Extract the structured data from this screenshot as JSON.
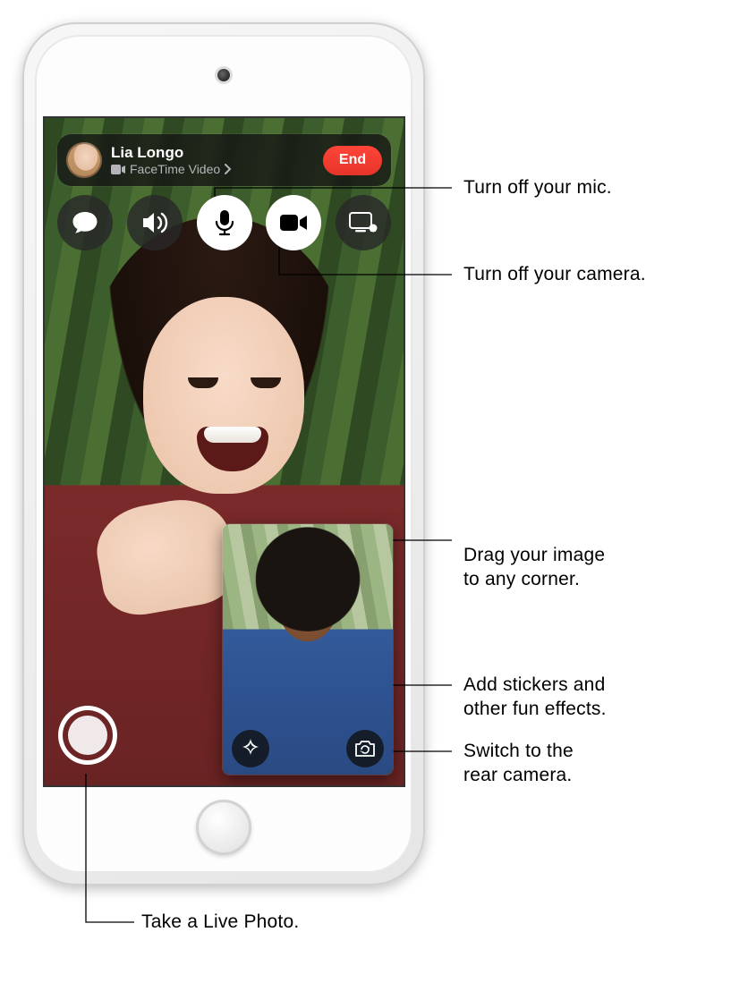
{
  "caller": {
    "name": "Lia Longo",
    "subtitle": "FaceTime Video"
  },
  "buttons": {
    "end": "End"
  },
  "icons": {
    "messages": "messages-icon",
    "speaker": "speaker-icon",
    "mic": "microphone-icon",
    "camera": "video-camera-icon",
    "share": "share-screen-icon",
    "effects": "effects-star-icon",
    "flip": "flip-camera-icon",
    "livephoto": "live-photo-icon",
    "chevron": "chevron-right-icon",
    "video_small": "video-small-icon"
  },
  "callouts": {
    "mic": "Turn off your mic.",
    "camera": "Turn off your camera.",
    "pip": "Drag your image\nto any corner.",
    "effects": "Add stickers and\nother fun effects.",
    "flip": "Switch to the\nrear camera.",
    "livephoto": "Take a Live Photo."
  }
}
